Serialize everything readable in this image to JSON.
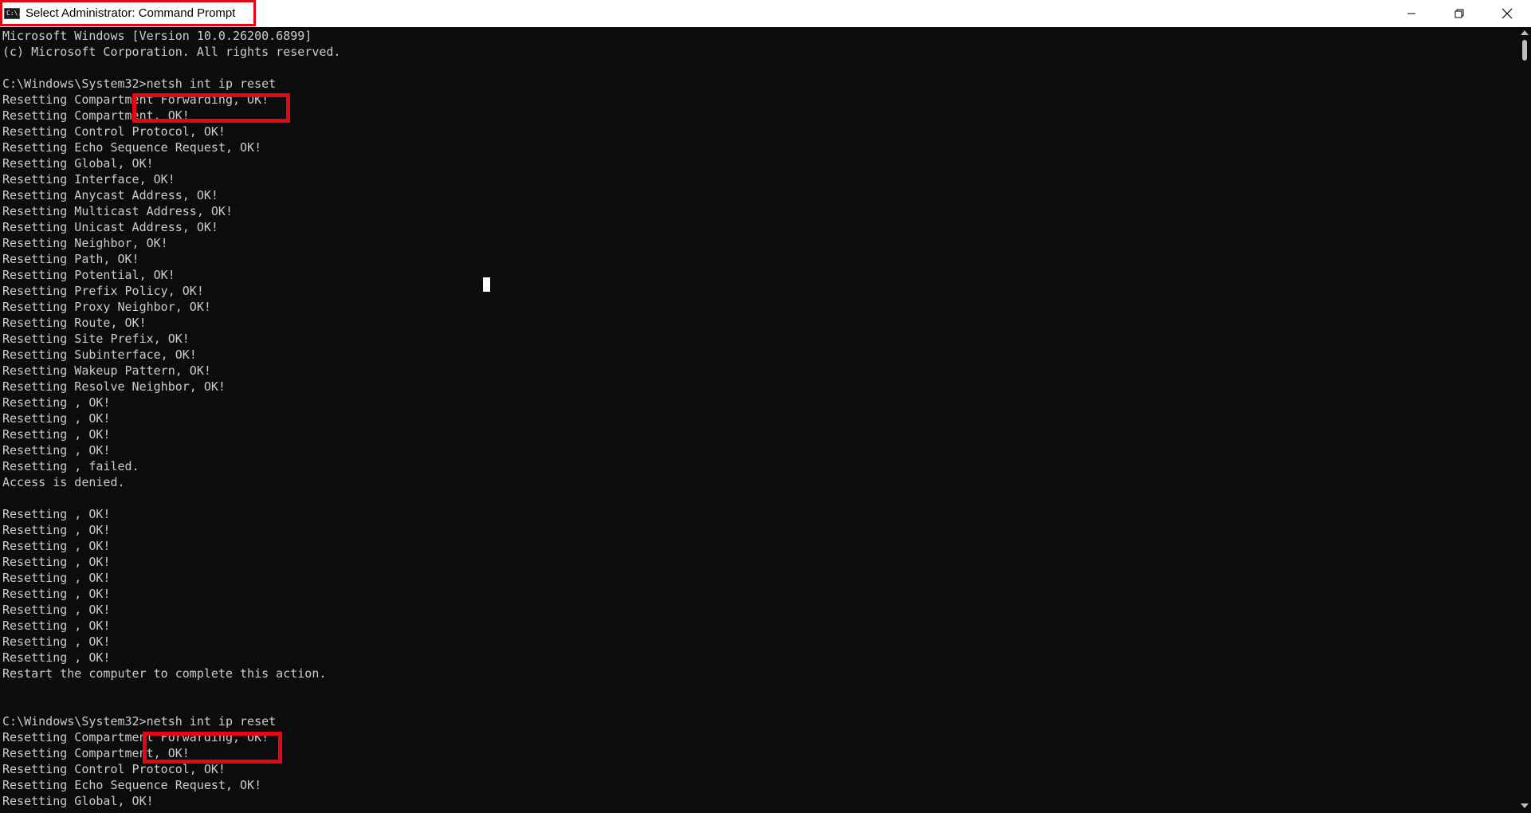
{
  "window": {
    "title": "Select Administrator: Command Prompt",
    "icon": "cmd-icon",
    "icon_text": "C:\\.",
    "controls": [
      "minimize-icon",
      "restore-icon",
      "close-icon"
    ]
  },
  "console": {
    "output": "Microsoft Windows [Version 10.0.26200.6899]\n(c) Microsoft Corporation. All rights reserved.\n\nC:\\Windows\\System32>netsh int ip reset\nResetting Compartment Forwarding, OK!\nResetting Compartment, OK!\nResetting Control Protocol, OK!\nResetting Echo Sequence Request, OK!\nResetting Global, OK!\nResetting Interface, OK!\nResetting Anycast Address, OK!\nResetting Multicast Address, OK!\nResetting Unicast Address, OK!\nResetting Neighbor, OK!\nResetting Path, OK!\nResetting Potential, OK!\nResetting Prefix Policy, OK!\nResetting Proxy Neighbor, OK!\nResetting Route, OK!\nResetting Site Prefix, OK!\nResetting Subinterface, OK!\nResetting Wakeup Pattern, OK!\nResetting Resolve Neighbor, OK!\nResetting , OK!\nResetting , OK!\nResetting , OK!\nResetting , OK!\nResetting , failed.\nAccess is denied.\n\nResetting , OK!\nResetting , OK!\nResetting , OK!\nResetting , OK!\nResetting , OK!\nResetting , OK!\nResetting , OK!\nResetting , OK!\nResetting , OK!\nResetting , OK!\nRestart the computer to complete this action.\n\n\nC:\\Windows\\System32>netsh int ip reset\nResetting Compartment Forwarding, OK!\nResetting Compartment, OK!\nResetting Control Protocol, OK!\nResetting Echo Sequence Request, OK!\nResetting Global, OK!"
  },
  "colors": {
    "console_background": "#0c0c0c",
    "console_text": "#cccccc",
    "highlight": "#e30613",
    "titlebar": "#ffffff"
  }
}
